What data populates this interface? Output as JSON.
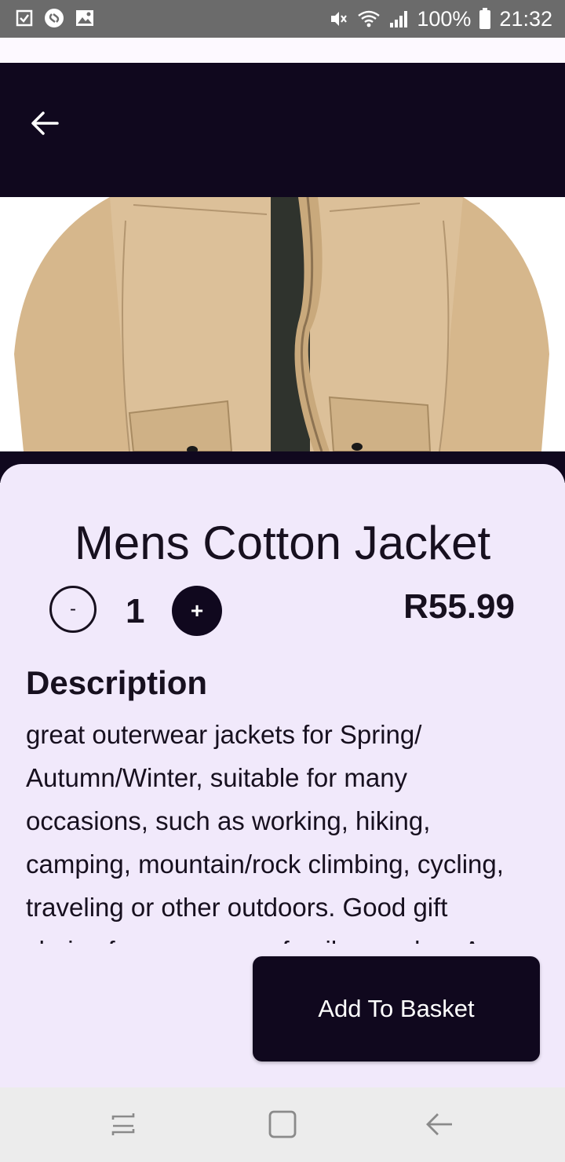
{
  "status_bar": {
    "battery": "100%",
    "time": "21:32",
    "left_icons": [
      "checkbox-notification-icon",
      "shazam-icon",
      "gallery-icon"
    ],
    "right_icons": [
      "mute-icon",
      "wifi-icon",
      "signal-icon",
      "battery-icon"
    ]
  },
  "header": {
    "back_icon": "arrow-back-icon"
  },
  "product": {
    "title": "Mens Cotton Jacket",
    "quantity": "1",
    "minus_label": "-",
    "plus_label": "+",
    "price": "R55.99",
    "image_description": "beige cotton jacket with zip",
    "description_heading": "Description",
    "description": "great outerwear jackets for Spring/ Autumn/Winter, suitable for many occasions, such as working, hiking, camping, mountain/rock climbing, cycling, traveling or other outdoors. Good gift choice for you or your family member. A warm hearted love to Father, husband or son in this thanksgiving or Christmas Day."
  },
  "actions": {
    "add_to_basket": "Add To Basket"
  },
  "nav": {
    "icons": [
      "recent-apps-icon",
      "home-icon",
      "back-icon"
    ]
  },
  "colors": {
    "primary_dark": "#10081e",
    "panel_bg": "#f1e9fb",
    "jacket": "#d9bc92"
  }
}
